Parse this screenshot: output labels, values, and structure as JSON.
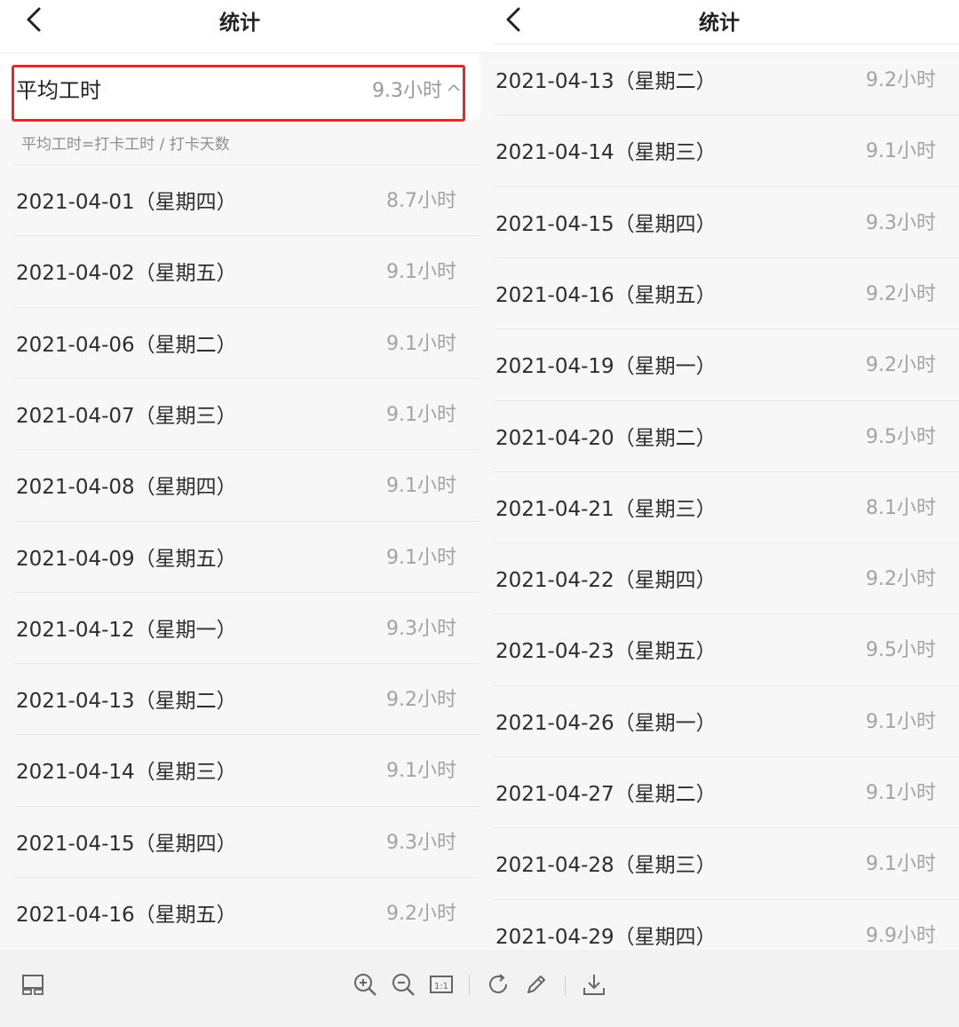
{
  "left": {
    "title": "统计",
    "avg_label": "平均工时",
    "avg_value": "9.3小时",
    "note": "平均工时=打卡工时 / 打卡天数",
    "records": [
      {
        "date": "2021-04-01（星期四）",
        "hours": "8.7小时"
      },
      {
        "date": "2021-04-02（星期五）",
        "hours": "9.1小时"
      },
      {
        "date": "2021-04-06（星期二）",
        "hours": "9.1小时"
      },
      {
        "date": "2021-04-07（星期三）",
        "hours": "9.1小时"
      },
      {
        "date": "2021-04-08（星期四）",
        "hours": "9.1小时"
      },
      {
        "date": "2021-04-09（星期五）",
        "hours": "9.1小时"
      },
      {
        "date": "2021-04-12（星期一）",
        "hours": "9.3小时"
      },
      {
        "date": "2021-04-13（星期二）",
        "hours": "9.2小时"
      },
      {
        "date": "2021-04-14（星期三）",
        "hours": "9.1小时"
      },
      {
        "date": "2021-04-15（星期四）",
        "hours": "9.3小时"
      },
      {
        "date": "2021-04-16（星期五）",
        "hours": "9.2小时"
      }
    ]
  },
  "right": {
    "title": "统计",
    "records": [
      {
        "date": "2021-04-13（星期二）",
        "hours": "9.2小时"
      },
      {
        "date": "2021-04-14（星期三）",
        "hours": "9.1小时"
      },
      {
        "date": "2021-04-15（星期四）",
        "hours": "9.3小时"
      },
      {
        "date": "2021-04-16（星期五）",
        "hours": "9.2小时"
      },
      {
        "date": "2021-04-19（星期一）",
        "hours": "9.2小时"
      },
      {
        "date": "2021-04-20（星期二）",
        "hours": "9.5小时"
      },
      {
        "date": "2021-04-21（星期三）",
        "hours": "8.1小时"
      },
      {
        "date": "2021-04-22（星期四）",
        "hours": "9.2小时"
      },
      {
        "date": "2021-04-23（星期五）",
        "hours": "9.5小时"
      },
      {
        "date": "2021-04-26（星期一）",
        "hours": "9.1小时"
      },
      {
        "date": "2021-04-27（星期二）",
        "hours": "9.1小时"
      },
      {
        "date": "2021-04-28（星期三）",
        "hours": "9.1小时"
      },
      {
        "date": "2021-04-29（星期四）",
        "hours": "9.9小时"
      }
    ]
  },
  "toolbar": {
    "icons": [
      "thumbnail-icon",
      "zoom-in-icon",
      "zoom-out-icon",
      "actual-size-icon",
      "rotate-icon",
      "edit-icon",
      "download-icon"
    ],
    "actual_size_label": "1:1"
  },
  "colors": {
    "highlight": "#e8262b",
    "hours_text": "#a3a3a3"
  }
}
